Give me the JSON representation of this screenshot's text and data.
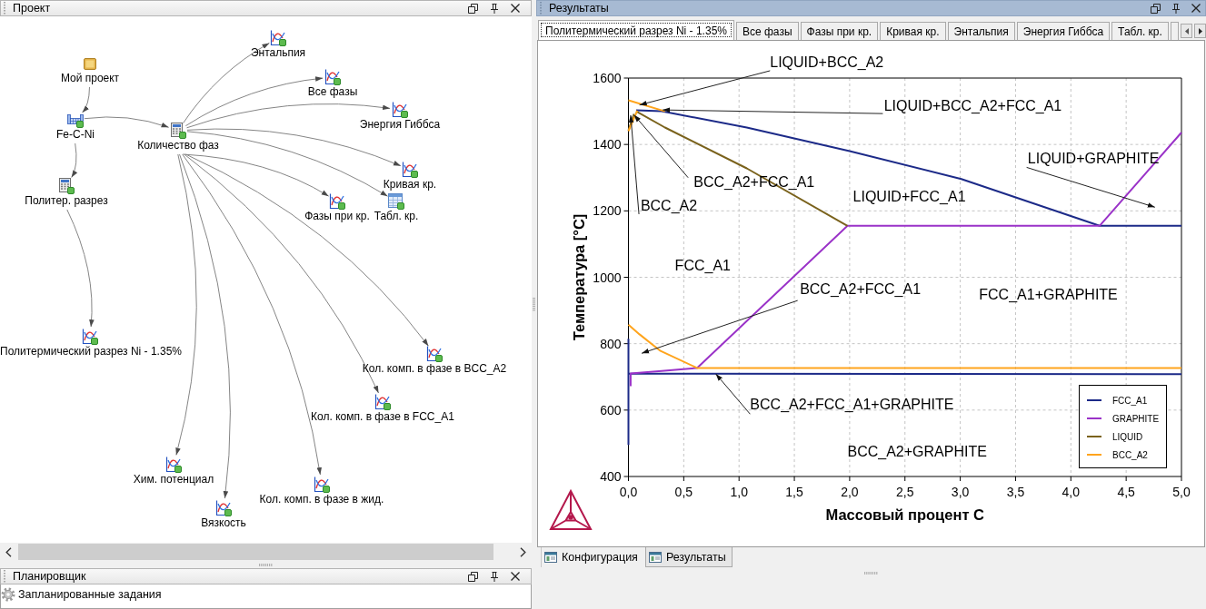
{
  "project_panel": {
    "title": "Проект",
    "graph": {
      "nodes": [
        {
          "label": "Мой проект",
          "kind": "project",
          "children": [
            {
              "label": "Fe-C-Ni",
              "kind": "system",
              "children": [
                {
                  "label": "Количество фаз",
                  "kind": "calculation",
                  "children": [
                    {
                      "label": "Энтальпия",
                      "kind": "plot"
                    },
                    {
                      "label": "Все фазы",
                      "kind": "plot"
                    },
                    {
                      "label": "Энергия Гиббса",
                      "kind": "plot"
                    },
                    {
                      "label": "Кривая кр.",
                      "kind": "plot"
                    },
                    {
                      "label": "Фазы при кр.",
                      "kind": "plot"
                    },
                    {
                      "label": "Табл. кр.",
                      "kind": "table"
                    },
                    {
                      "label": "Кол. комп. в фазе в BCC_A2",
                      "kind": "plot"
                    },
                    {
                      "label": "Кол. комп. в фазе в FCC_A1",
                      "kind": "plot"
                    },
                    {
                      "label": "Хим. потенциал",
                      "kind": "plot"
                    },
                    {
                      "label": "Кол. комп. в фазе в жид.",
                      "kind": "plot"
                    },
                    {
                      "label": "Вязкость",
                      "kind": "plot"
                    }
                  ]
                },
                {
                  "label": "Политер. разрез",
                  "kind": "calculation",
                  "children": [
                    {
                      "label": "Политермический разрез Ni - 1.35%",
                      "kind": "plot"
                    }
                  ]
                }
              ]
            }
          ]
        }
      ]
    }
  },
  "scheduler_panel": {
    "title": "Планировщик",
    "items": [
      {
        "label": "Запланированные задания"
      }
    ]
  },
  "results_panel": {
    "title": "Результаты",
    "tabs": [
      {
        "label": "Политермический разрез Ni - 1.35%",
        "selected": true
      },
      {
        "label": "Все фазы",
        "selected": false
      },
      {
        "label": "Фазы при кр.",
        "selected": false
      },
      {
        "label": "Кривая кр.",
        "selected": false
      },
      {
        "label": "Энтальпия",
        "selected": false
      },
      {
        "label": "Энергия Гиббса",
        "selected": false
      },
      {
        "label": "Табл. кр.",
        "selected": false
      }
    ],
    "chart_data": {
      "type": "line",
      "xlabel": "Массовый процент C",
      "ylabel": "Температура [°C]",
      "xlim": [
        0,
        5
      ],
      "ylim": [
        400,
        1600
      ],
      "grid": true,
      "legend": true,
      "xticks": [
        {
          "value": 0,
          "label": "0,0"
        },
        {
          "value": 0.5,
          "label": "0,5"
        },
        {
          "value": 1,
          "label": "1,0"
        },
        {
          "value": 1.5,
          "label": "1,5"
        },
        {
          "value": 2,
          "label": "2,0"
        },
        {
          "value": 2.5,
          "label": "2,5"
        },
        {
          "value": 3,
          "label": "3,0"
        },
        {
          "value": 3.5,
          "label": "3,5"
        },
        {
          "value": 4,
          "label": "4,0"
        },
        {
          "value": 4.5,
          "label": "4,5"
        },
        {
          "value": 5,
          "label": "5,0"
        }
      ],
      "yticks": [
        400,
        600,
        800,
        1000,
        1200,
        1400,
        1600
      ],
      "series": [
        {
          "name": "FCC_A1",
          "color": "#1c2a88",
          "x": [
            0.07,
            0.3,
            1.07,
            2.0,
            3.01,
            4.26,
            5.0,
            null,
            0.0,
            5.0,
            null,
            0.0,
            0.0
          ],
          "values": [
            1503,
            1500,
            1451,
            1380,
            1296,
            1155,
            1155,
            null,
            710,
            708,
            null,
            495,
            815
          ]
        },
        {
          "name": "GRAPHITE",
          "color": "#9a32c8",
          "x": [
            0.02,
            0.02,
            0.3,
            0.62,
            1.98,
            4.26,
            5.0
          ],
          "values": [
            672,
            710,
            718,
            727,
            1155,
            1155,
            1436
          ]
        },
        {
          "name": "LIQUID",
          "color": "#7a621c",
          "x": [
            0.0,
            0.05,
            null,
            0.07,
            0.33,
            1.07,
            1.98
          ],
          "values": [
            1442,
            1492,
            null,
            1500,
            1451,
            1328,
            1155
          ]
        },
        {
          "name": "BCC_A2",
          "color": "#ffa41c",
          "x": [
            0.0,
            0.33,
            null,
            0.0,
            0.08,
            null,
            0.0,
            0.1,
            0.29,
            0.62,
            5.0
          ],
          "values": [
            1533,
            1500,
            null,
            1440,
            1502,
            null,
            857,
            828,
            778,
            727,
            727
          ]
        }
      ],
      "annotations": [
        "LIQUID+BCC_A2",
        "LIQUID+BCC_A2+FCC_A1",
        "BCC_A2+FCC_A1",
        "BCC_A2",
        "LIQUID+FCC_A1",
        "LIQUID+GRAPHITE",
        "FCC_A1",
        "BCC_A2+FCC_A1",
        "FCC_A1+GRAPHITE",
        "BCC_A2+FCC_A1+GRAPHITE",
        "BCC_A2+GRAPHITE"
      ]
    },
    "bottom_tabs": [
      {
        "label": "Конфигурация",
        "selected": false
      },
      {
        "label": "Результаты",
        "selected": true
      }
    ]
  }
}
